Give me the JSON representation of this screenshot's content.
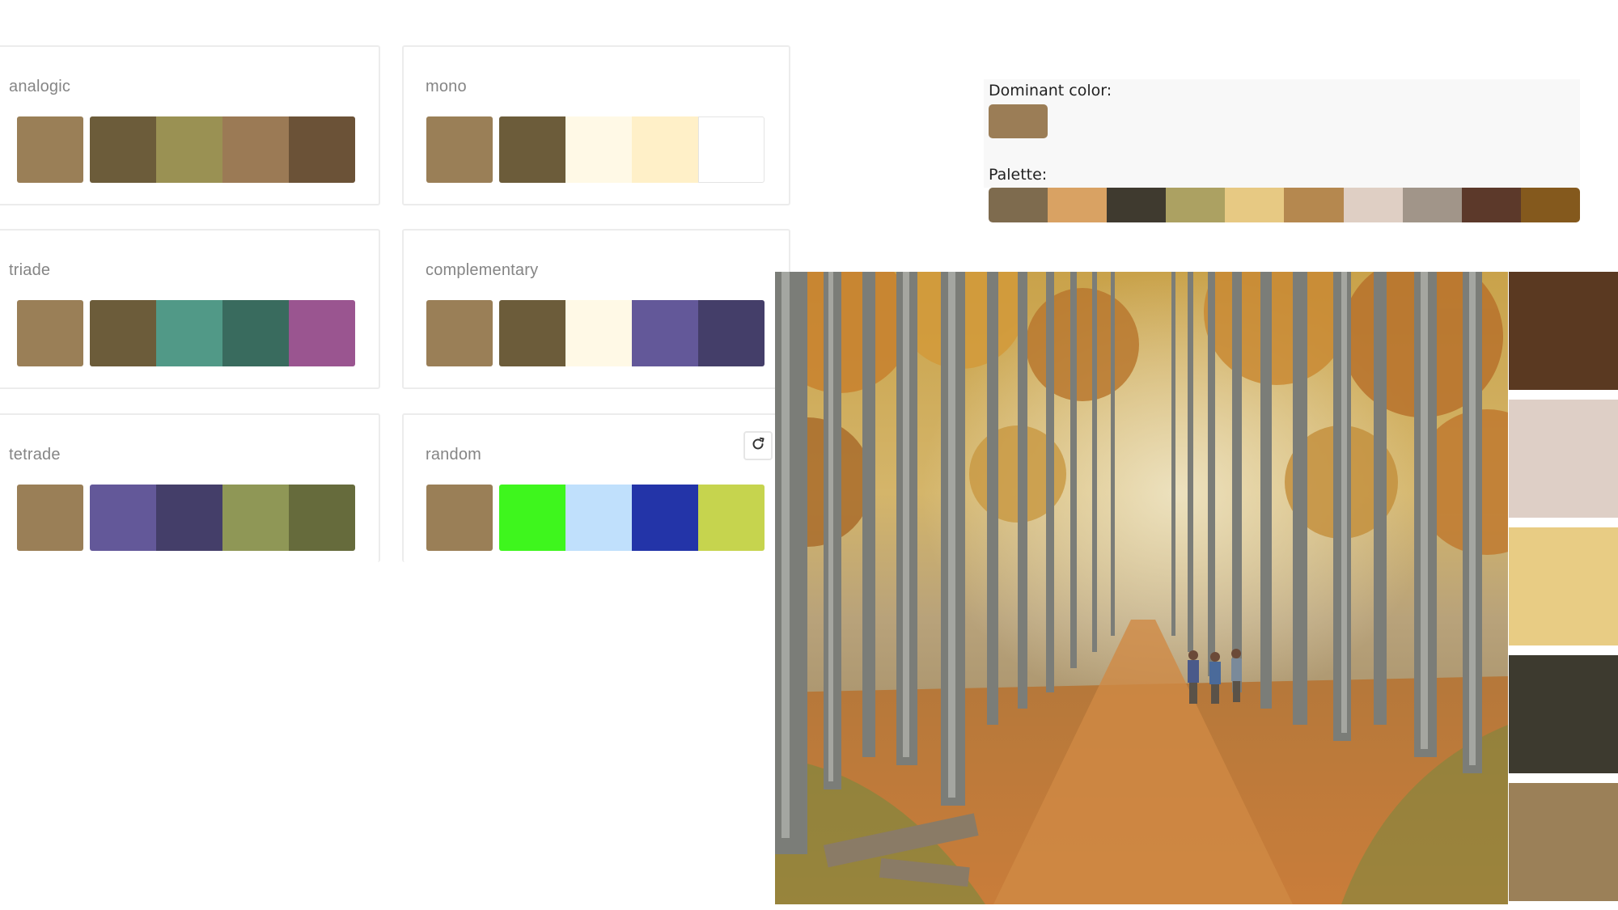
{
  "schemes": [
    {
      "id": "analogic",
      "title": "analogic",
      "colors": [
        "#9a7f57",
        "#6c5c3a",
        "#9a9153",
        "#9b7a55",
        "#6b5237"
      ]
    },
    {
      "id": "mono",
      "title": "mono",
      "colors": [
        "#9a7f57",
        "#6c5c3a",
        "#fff9e6",
        "#fff0c8",
        "#ffffff"
      ]
    },
    {
      "id": "triade",
      "title": "triade",
      "colors": [
        "#9a7f57",
        "#6c5c3a",
        "#519987",
        "#396b5e",
        "#9a5590"
      ]
    },
    {
      "id": "complementary",
      "title": "complementary",
      "colors": [
        "#9a7f57",
        "#6c5c3a",
        "#fff9e6",
        "#635899",
        "#443e69"
      ]
    },
    {
      "id": "tetrade",
      "title": "tetrade",
      "colors": [
        "#9a7f57",
        "#635899",
        "#443e69",
        "#8f9756",
        "#666b3c"
      ]
    },
    {
      "id": "random",
      "title": "random",
      "colors": [
        "#9a7f57",
        "#3ef61d",
        "#c0e0fc",
        "#2334a8",
        "#c6d44e"
      ],
      "refresh_icon": "refresh-icon"
    }
  ],
  "dominant": {
    "label": "Dominant color:",
    "color": "#9b7d56"
  },
  "palette": {
    "label": "Palette:",
    "colors": [
      "#7e6b4e",
      "#d9a263",
      "#3f3a2f",
      "#aca162",
      "#e7c983",
      "#b5884f",
      "#dfcfc4",
      "#a19589",
      "#5c392a",
      "#84591d"
    ]
  },
  "photo": {
    "description_icon": "autumn-forest-photo"
  },
  "side_swatches": [
    "#5a3921",
    "#decfc6",
    "#e8cc84",
    "#3d3a2f",
    "#9b8058"
  ]
}
